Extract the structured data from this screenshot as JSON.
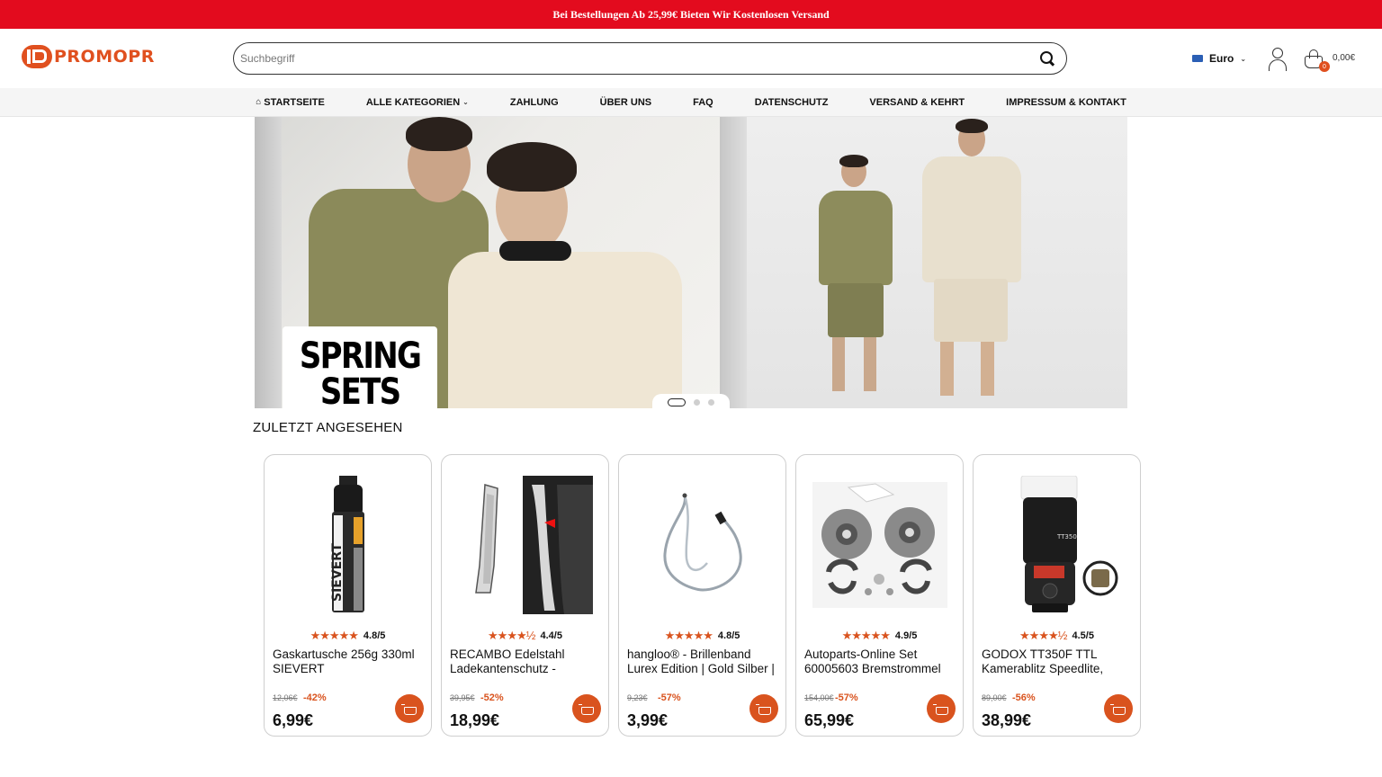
{
  "topbar": {
    "text": "Bei Bestellungen Ab 25,99€ Bieten Wir Kostenlosen Versand"
  },
  "header": {
    "logo_text": "PROMOPR",
    "search": {
      "placeholder": "Suchbegriff",
      "value": ""
    },
    "currency": "Euro",
    "cart": {
      "count": "0",
      "total": "0,00€"
    }
  },
  "nav": {
    "items": [
      {
        "label": "STARTSEITE"
      },
      {
        "label": "ALLE KATEGORIEN"
      },
      {
        "label": "ZAHLUNG"
      },
      {
        "label": "ÜBER UNS"
      },
      {
        "label": "FAQ"
      },
      {
        "label": "DATENSCHUTZ"
      },
      {
        "label": "VERSAND & KEHRT"
      },
      {
        "label": "IMPRESSUM & KONTAKT"
      }
    ]
  },
  "hero": {
    "promo_line1": "SPRING",
    "promo_line2": "SETS",
    "slides": 3,
    "active_slide": 1
  },
  "recent": {
    "title": "ZULETZT ANGESEHEN",
    "products": [
      {
        "rating": "4.8/5",
        "stars": "★★★★★",
        "title": "Gaskartusche 256g 330ml SIEVERT",
        "old_price": "12,06€",
        "discount": "-42%",
        "price": "6,99€"
      },
      {
        "rating": "4.4/5",
        "stars": "★★★★½",
        "title": "RECAMBO Edelstahl Ladekantenschutz -",
        "old_price": "39,95€",
        "discount": "-52%",
        "price": "18,99€"
      },
      {
        "rating": "4.8/5",
        "stars": "★★★★★",
        "title": "hangloo® - Brillenband Lurex Edition | Gold Silber |",
        "old_price": "9,23€",
        "discount": "-57%",
        "price": "3,99€"
      },
      {
        "rating": "4.9/5",
        "stars": "★★★★★",
        "title": "Autoparts-Online Set 60005603 Bremstrommel",
        "old_price": "154,00€",
        "discount": "-57%",
        "price": "65,99€"
      },
      {
        "rating": "4.5/5",
        "stars": "★★★★½",
        "title": "GODOX TT350F TTL Kamerablitz Speedlite,",
        "old_price": "89,00€",
        "discount": "-56%",
        "price": "38,99€"
      }
    ]
  },
  "colors": {
    "topbar": "#e30b1e",
    "accent": "#d9531e"
  }
}
